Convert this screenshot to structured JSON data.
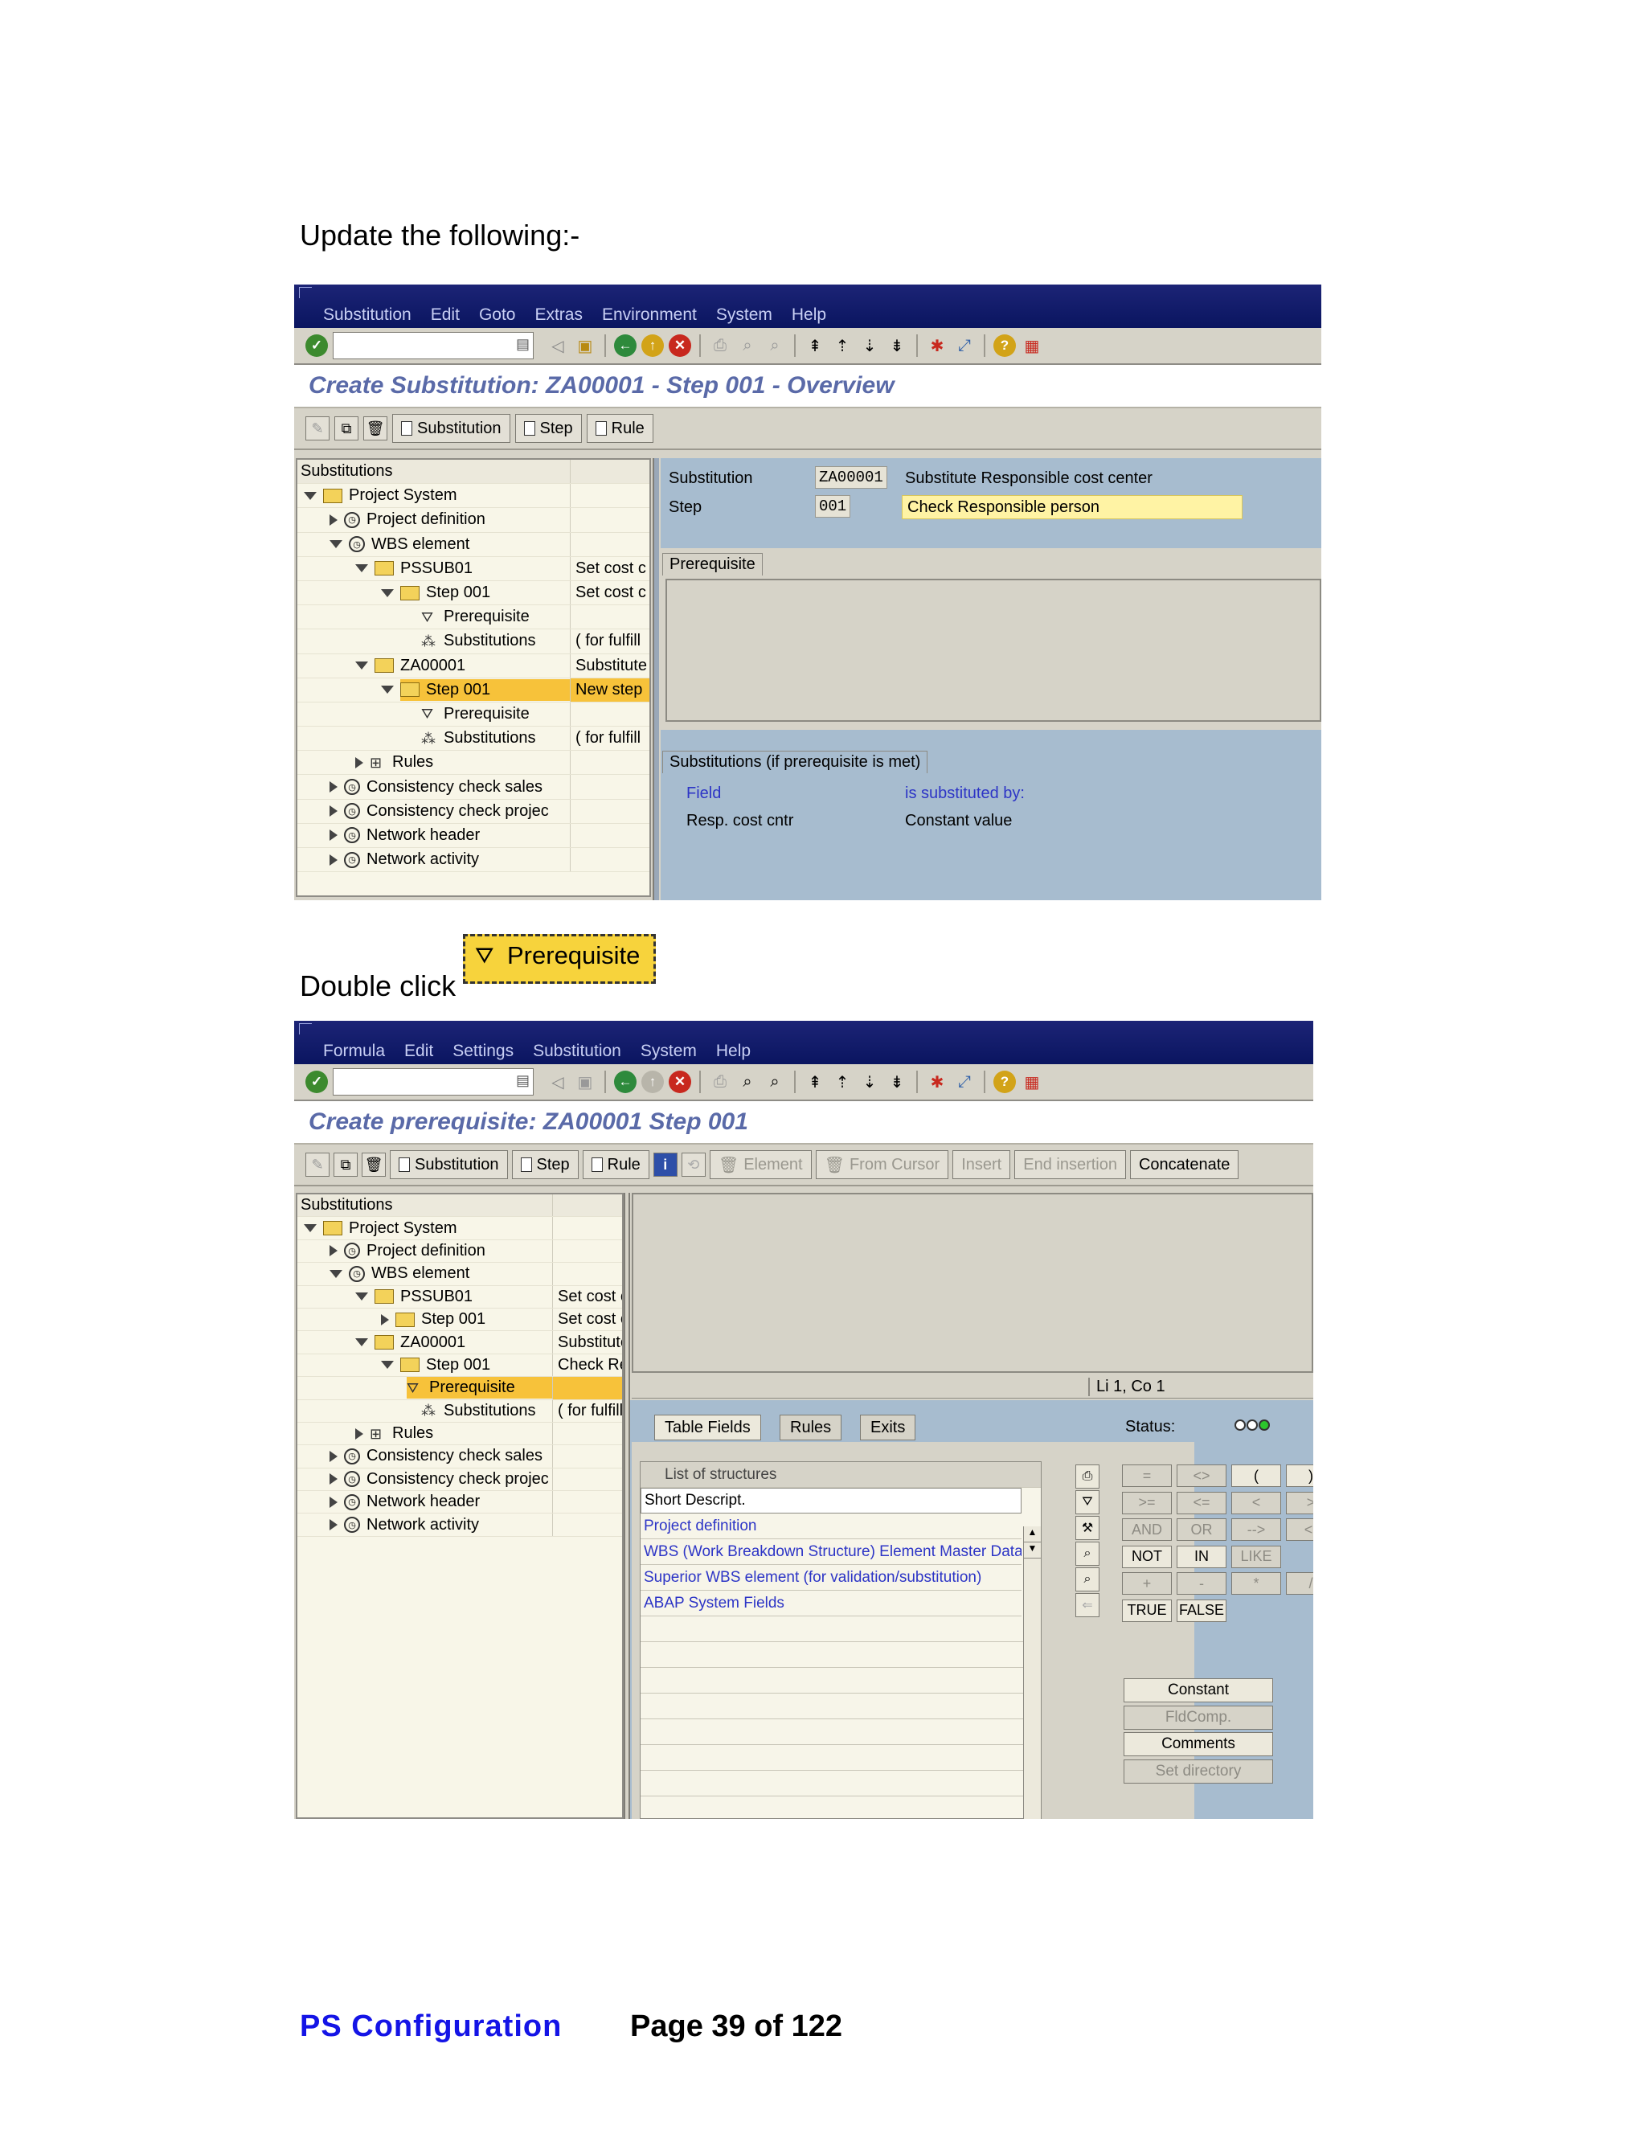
{
  "intro_text": "Update the following:-",
  "double_click_text": "Double click",
  "prereq_image_label": "Prerequisite",
  "footer": {
    "left": "PS  Configuration",
    "right": "Page 39 of 122"
  },
  "screen1": {
    "menu": [
      "Substitution",
      "Edit",
      "Goto",
      "Extras",
      "Environment",
      "System",
      "Help"
    ],
    "title": "Create Substitution: ZA00001 - Step 001 - Overview",
    "app_buttons": [
      "Substitution",
      "Step",
      "Rule"
    ],
    "tree_header": "Substitutions",
    "tree": [
      {
        "label": "Project System",
        "col2": "",
        "indent": 0,
        "icon": "folder",
        "exp": "d"
      },
      {
        "label": "Project definition",
        "col2": "",
        "indent": 1,
        "icon": "clock",
        "exp": "r"
      },
      {
        "label": "WBS element",
        "col2": "",
        "indent": 1,
        "icon": "clock",
        "exp": "d"
      },
      {
        "label": "PSSUB01",
        "col2": "Set cost c",
        "indent": 2,
        "icon": "folder",
        "exp": "d"
      },
      {
        "label": "Step 001",
        "col2": "Set cost c",
        "indent": 3,
        "icon": "folder",
        "exp": "d"
      },
      {
        "label": "Prerequisite",
        "col2": "",
        "indent": 4,
        "icon": "filter",
        "exp": ""
      },
      {
        "label": "Substitutions",
        "col2": "( for fulfill",
        "indent": 4,
        "icon": "subst",
        "exp": ""
      },
      {
        "label": "ZA00001",
        "col2": "Substitute",
        "indent": 2,
        "icon": "folder",
        "exp": "d"
      },
      {
        "label": "Step 001",
        "col2": "New step",
        "indent": 3,
        "icon": "folder",
        "exp": "d",
        "hl": true
      },
      {
        "label": "Prerequisite",
        "col2": "",
        "indent": 4,
        "icon": "filter",
        "exp": ""
      },
      {
        "label": "Substitutions",
        "col2": "( for fulfill",
        "indent": 4,
        "icon": "subst",
        "exp": ""
      },
      {
        "label": "Rules",
        "col2": "",
        "indent": 2,
        "icon": "rules",
        "exp": "r"
      },
      {
        "label": "Consistency check sales",
        "col2": "",
        "indent": 1,
        "icon": "clock",
        "exp": "r"
      },
      {
        "label": "Consistency check projec",
        "col2": "",
        "indent": 1,
        "icon": "clock",
        "exp": "r"
      },
      {
        "label": "Network header",
        "col2": "",
        "indent": 1,
        "icon": "clock",
        "exp": "r"
      },
      {
        "label": "Network activity",
        "col2": "",
        "indent": 1,
        "icon": "clock",
        "exp": "r"
      }
    ],
    "substitution_label": "Substitution",
    "substitution_value": "ZA00001",
    "substitution_desc": "Substitute Responsible cost center",
    "step_label": "Step",
    "step_value": "001",
    "step_desc": "Check Responsible person",
    "prereq_frame": "Prerequisite",
    "subst_frame": "Substitutions (if prerequisite is met)",
    "col_field": "Field",
    "col_subst": "is substituted by:",
    "row_field": "Resp. cost cntr",
    "row_value": "Constant value"
  },
  "screen2": {
    "menu": [
      "Formula",
      "Edit",
      "Settings",
      "Substitution",
      "System",
      "Help"
    ],
    "title": "Create prerequisite: ZA00001 Step 001",
    "app_buttons": [
      "Substitution",
      "Step",
      "Rule",
      "Element",
      "From Cursor",
      "Insert",
      "End insertion",
      "Concatenate"
    ],
    "tree_header": "Substitutions",
    "tree": [
      {
        "label": "Project System",
        "col2": "",
        "indent": 0,
        "icon": "folder",
        "exp": "d"
      },
      {
        "label": "Project definition",
        "col2": "",
        "indent": 1,
        "icon": "clock",
        "exp": "r"
      },
      {
        "label": "WBS element",
        "col2": "",
        "indent": 1,
        "icon": "clock",
        "exp": "d"
      },
      {
        "label": "PSSUB01",
        "col2": "Set cost c",
        "indent": 2,
        "icon": "folder",
        "exp": "d"
      },
      {
        "label": "Step 001",
        "col2": "Set cost c",
        "indent": 3,
        "icon": "folder",
        "exp": "r"
      },
      {
        "label": "ZA00001",
        "col2": "Substitute",
        "indent": 2,
        "icon": "folder",
        "exp": "d"
      },
      {
        "label": "Step 001",
        "col2": "Check Re",
        "indent": 3,
        "icon": "folder",
        "exp": "d"
      },
      {
        "label": "Prerequisite",
        "col2": "",
        "indent": 4,
        "icon": "filter",
        "exp": "",
        "hl": true
      },
      {
        "label": "Substitutions",
        "col2": "( for fulfill",
        "indent": 4,
        "icon": "subst",
        "exp": ""
      },
      {
        "label": "Rules",
        "col2": "",
        "indent": 2,
        "icon": "rules",
        "exp": "r"
      },
      {
        "label": "Consistency check sales",
        "col2": "",
        "indent": 1,
        "icon": "clock",
        "exp": "r"
      },
      {
        "label": "Consistency check projec",
        "col2": "",
        "indent": 1,
        "icon": "clock",
        "exp": "r"
      },
      {
        "label": "Network header",
        "col2": "",
        "indent": 1,
        "icon": "clock",
        "exp": "r"
      },
      {
        "label": "Network activity",
        "col2": "",
        "indent": 1,
        "icon": "clock",
        "exp": "r"
      }
    ],
    "cursor_pos": "Li 1, Co 1",
    "tabs": [
      "Table Fields",
      "Rules",
      "Exits"
    ],
    "status_label": "Status:",
    "list_header": "List of structures",
    "list_items": [
      {
        "text": "Short Descript.",
        "blue": false
      },
      {
        "text": "Project definition",
        "blue": true
      },
      {
        "text": "WBS (Work Breakdown Structure) Element Master Data",
        "blue": true
      },
      {
        "text": "Superior WBS element (for validation/substitution)",
        "blue": true
      },
      {
        "text": "ABAP System Fields",
        "blue": true
      }
    ],
    "operators": [
      [
        "=",
        "<>",
        "(",
        ")"
      ],
      [
        ">=",
        "<=",
        "<",
        ">"
      ],
      [
        "AND",
        "OR",
        "-->",
        "<-"
      ],
      [
        "NOT",
        "IN",
        "LIKE",
        ""
      ],
      [
        "+",
        "-",
        "*",
        "/"
      ],
      [
        "TRUE",
        "FALSE",
        "",
        ""
      ]
    ],
    "right_buttons": [
      "Constant",
      "FldComp.",
      "Comments",
      "Set directory"
    ]
  },
  "colors": {
    "menubar": "#0f1a6a",
    "title": "#5a6aa8",
    "highlight": "#f7c23a",
    "input": "#fff3a4",
    "footer_blue": "#1414e6"
  }
}
